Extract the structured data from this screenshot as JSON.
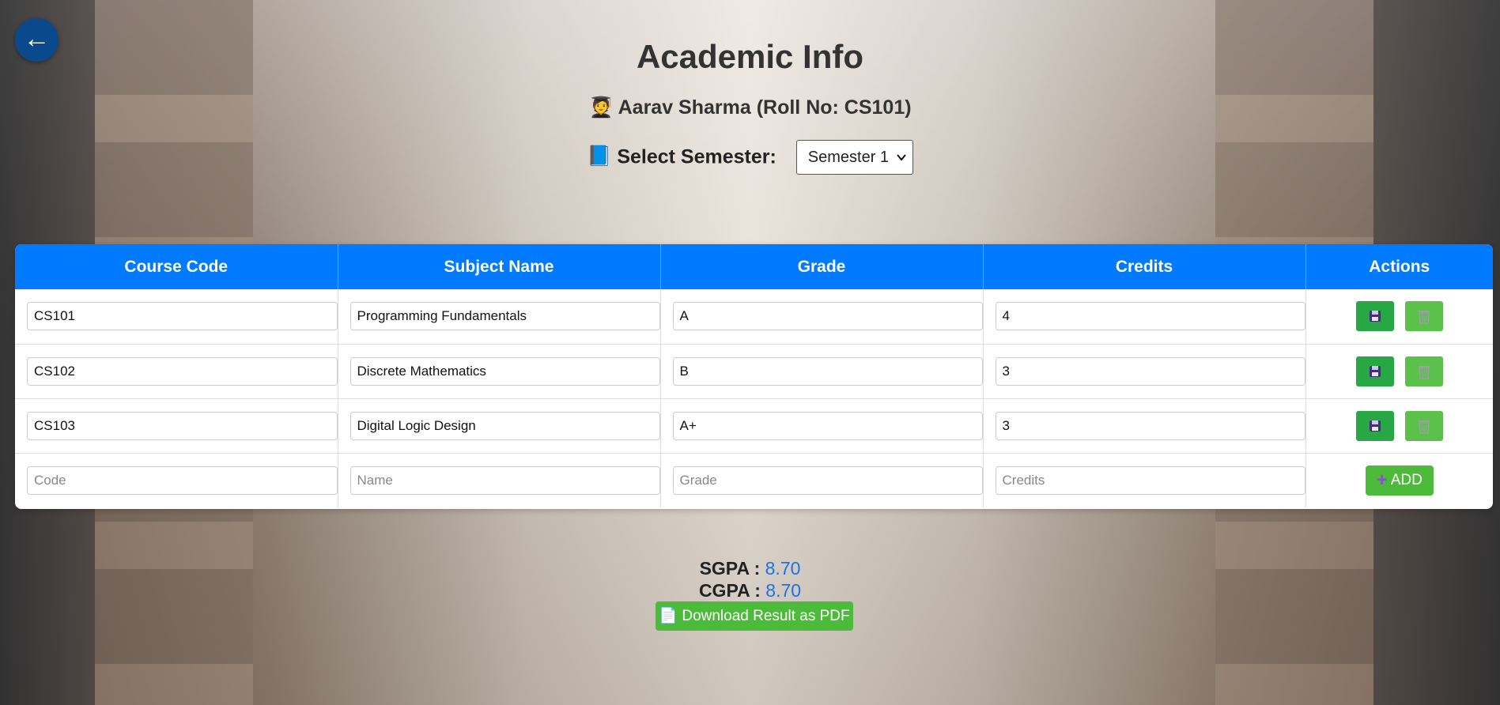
{
  "header": {
    "back_icon": "←",
    "title": "Academic Info",
    "student_icon": "🧑‍🎓",
    "student": "Aarav Sharma (Roll No: CS101)"
  },
  "semester": {
    "icon": "📘",
    "label": "Select Semester:",
    "selected": "Semester 1"
  },
  "table": {
    "headers": [
      "Course Code",
      "Subject Name",
      "Grade",
      "Credits",
      "Actions"
    ],
    "rows": [
      {
        "code": "CS101",
        "name": "Programming Fundamentals",
        "grade": "A",
        "credits": "4"
      },
      {
        "code": "CS102",
        "name": "Discrete Mathematics",
        "grade": "B",
        "credits": "3"
      },
      {
        "code": "CS103",
        "name": "Digital Logic Design",
        "grade": "A+",
        "credits": "3"
      }
    ],
    "new_row": {
      "code_placeholder": "Code",
      "name_placeholder": "Name",
      "grade_placeholder": "Grade",
      "credits_placeholder": "Credits",
      "add_label": "ADD",
      "add_icon": "+"
    }
  },
  "summary": {
    "sgpa_label": "SGPA :",
    "sgpa": "8.70",
    "cgpa_label": "CGPA :",
    "cgpa": "8.70"
  },
  "pdf_button": {
    "icon": "📄",
    "label": "Download Result as PDF"
  },
  "colors": {
    "header_blue": "#007bff",
    "save_green": "#28a745",
    "delete_green": "#5cc14a",
    "value_blue": "#1a73e8",
    "back_button": "#0a4a8c"
  }
}
